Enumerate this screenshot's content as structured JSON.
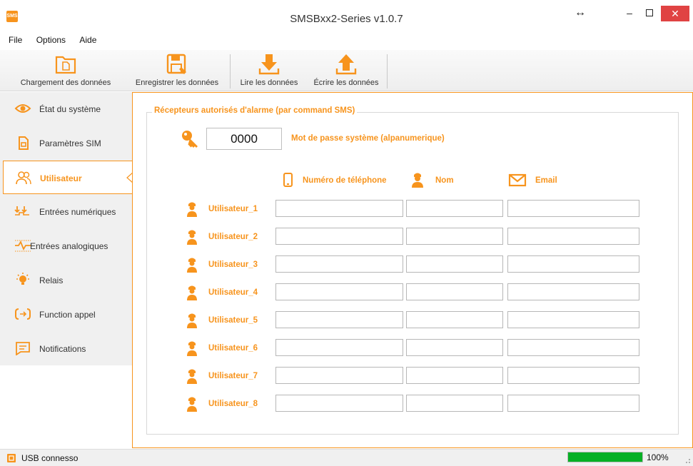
{
  "window": {
    "title": "SMSBxx2-Series v1.0.7",
    "app_icon": "sms-app-icon",
    "app_icon_text": "SMS",
    "resize_glyph": "↔",
    "minimize_glyph": "–",
    "close_glyph": "✕"
  },
  "menu": [
    "File",
    "Options",
    "Aide"
  ],
  "toolbar": {
    "load_label": "Chargement des données",
    "save_label": "Enregistrer les données",
    "read_label": "Lire les données",
    "write_label": "Écrire les données"
  },
  "sidebar": {
    "items": [
      {
        "label": "État du système",
        "icon": "eye-icon"
      },
      {
        "label": "Paramètres SIM",
        "icon": "sim-card-icon"
      },
      {
        "label": "Utilisateur",
        "icon": "users-icon",
        "active": true
      },
      {
        "label": "Entrées numériques",
        "icon": "digital-input-icon"
      },
      {
        "label": "Entrées analogiques",
        "icon": "analog-input-icon"
      },
      {
        "label": "Relais",
        "icon": "relay-bulb-icon"
      },
      {
        "label": "Function appel",
        "icon": "call-function-icon"
      },
      {
        "label": "Notifications",
        "icon": "notification-icon"
      }
    ]
  },
  "main": {
    "group_title": "Récepteurs autorisés d'alarme (par command SMS)",
    "password": {
      "value": "0000",
      "label": "Mot de passe système (alpanumerique)"
    },
    "columns": {
      "phone": "Numéro de téléphone",
      "name": "Nom",
      "email": "Email"
    },
    "users": [
      {
        "label": "Utilisateur_1",
        "phone": "",
        "name": "",
        "email": ""
      },
      {
        "label": "Utilisateur_2",
        "phone": "",
        "name": "",
        "email": ""
      },
      {
        "label": "Utilisateur_3",
        "phone": "",
        "name": "",
        "email": ""
      },
      {
        "label": "Utilisateur_4",
        "phone": "",
        "name": "",
        "email": ""
      },
      {
        "label": "Utilisateur_5",
        "phone": "",
        "name": "",
        "email": ""
      },
      {
        "label": "Utilisateur_6",
        "phone": "",
        "name": "",
        "email": ""
      },
      {
        "label": "Utilisateur_7",
        "phone": "",
        "name": "",
        "email": ""
      },
      {
        "label": "Utilisateur_8",
        "phone": "",
        "name": "",
        "email": ""
      }
    ]
  },
  "status": {
    "connection": "USB connesso",
    "progress_percent": 100,
    "progress_text": "100%"
  },
  "colors": {
    "accent": "#f7941d",
    "progress": "#06b025",
    "close_button": "#e04343"
  }
}
